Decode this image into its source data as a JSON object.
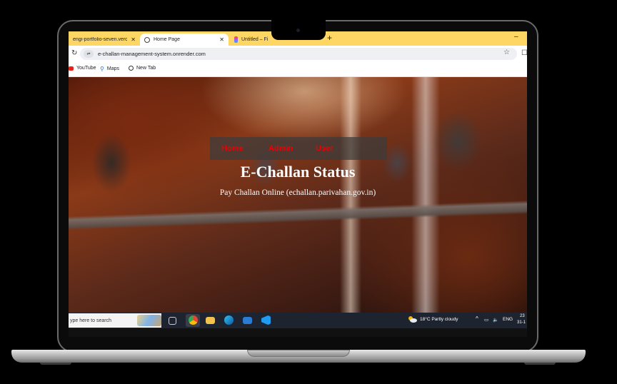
{
  "browser": {
    "tabs": [
      {
        "label": "engi-portfolio-seven.vercel",
        "active": false
      },
      {
        "label": "Home Page",
        "active": true
      },
      {
        "label": "Untitled – Fi",
        "active": false
      }
    ],
    "url": "e-challan-management-system.onrender.com",
    "bookmarks": [
      {
        "label": "YouTube"
      },
      {
        "label": "Maps"
      },
      {
        "label": "New Tab"
      }
    ]
  },
  "page": {
    "nav": [
      {
        "label": "Home"
      },
      {
        "label": "Admin"
      },
      {
        "label": "User"
      }
    ],
    "title": "E-Challan Status",
    "subtitle": "Pay Challan Online (echallan.parivahan.gov.in)"
  },
  "taskbar": {
    "search_placeholder": "ype here to search",
    "weather": "18°C  Partly cloudy",
    "language": "ENG",
    "time": "23",
    "date": "31-1"
  },
  "colors": {
    "tab_strip": "#fdd663",
    "nav_link": "#ee0000",
    "taskbar": "#1d2430"
  }
}
